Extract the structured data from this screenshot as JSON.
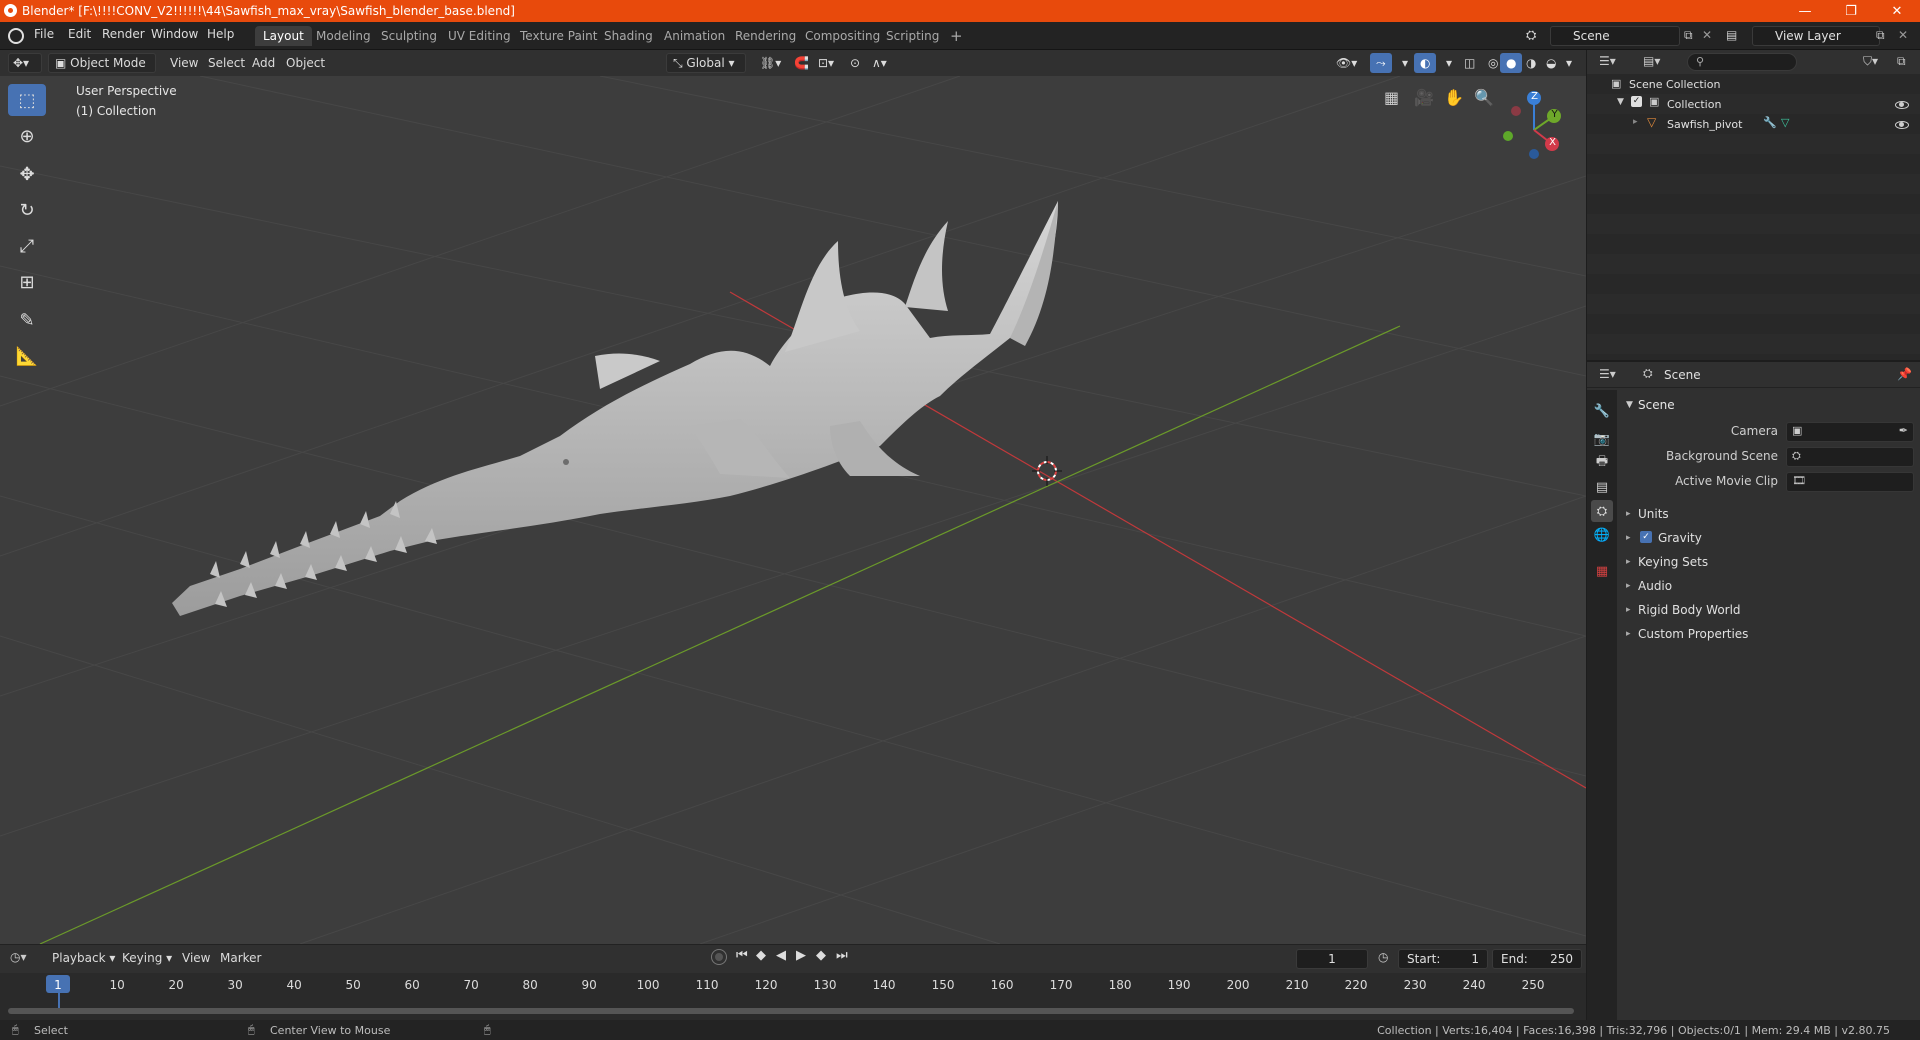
{
  "window": {
    "title": "Blender* [F:\\!!!!CONV_V2!!!!!!\\44\\Sawfish_max_vray\\Sawfish_blender_base.blend]",
    "controls": [
      "—",
      "❐",
      "✕"
    ]
  },
  "menu": [
    "File",
    "Edit",
    "Render",
    "Window",
    "Help"
  ],
  "workspaces": [
    "Layout",
    "Modeling",
    "Sculpting",
    "UV Editing",
    "Texture Paint",
    "Shading",
    "Animation",
    "Rendering",
    "Compositing",
    "Scripting"
  ],
  "workspace_add": "+",
  "active_workspace": "Layout",
  "scene_field": "Scene",
  "view_layer_field": "View Layer",
  "header3d": {
    "mode": "Object Mode",
    "menus": [
      "View",
      "Select",
      "Add",
      "Object"
    ],
    "orientation": "Global"
  },
  "viewport": {
    "perspective": "User Perspective",
    "collection": "(1) Collection",
    "gizmo": {
      "x": "X",
      "y": "Y",
      "z": "Z"
    }
  },
  "outliner": {
    "root": "Scene Collection",
    "collection": "Collection",
    "object": "Sawfish_pivot"
  },
  "properties": {
    "header": "Scene",
    "panel": "Scene",
    "fields": [
      {
        "label": "Camera"
      },
      {
        "label": "Background Scene"
      },
      {
        "label": "Active Movie Clip"
      }
    ],
    "subpanels": [
      "Units",
      "Gravity",
      "Keying Sets",
      "Audio",
      "Rigid Body World",
      "Custom Properties"
    ]
  },
  "timeline": {
    "menus": [
      "Playback",
      "Keying",
      "View",
      "Marker"
    ],
    "current_frame": "1",
    "start_label": "Start:",
    "start": "1",
    "end_label": "End:",
    "end": "250",
    "ticks": [
      "1",
      "10",
      "20",
      "30",
      "40",
      "50",
      "60",
      "70",
      "80",
      "90",
      "100",
      "110",
      "120",
      "130",
      "140",
      "150",
      "160",
      "170",
      "180",
      "190",
      "200",
      "210",
      "220",
      "230",
      "240",
      "250"
    ]
  },
  "status": {
    "left": "Select",
    "middle": "Center View to Mouse",
    "right": "Collection | Verts:16,404 | Faces:16,398 | Tris:32,796 | Objects:0/1 | Mem: 29.4 MB | v2.80.75"
  },
  "colors": {
    "accent": "#4772b3",
    "titlebar": "#e84a0c",
    "axis_x": "#c0393b",
    "axis_y": "#6b9a2a",
    "model": "#bdbdbd"
  }
}
